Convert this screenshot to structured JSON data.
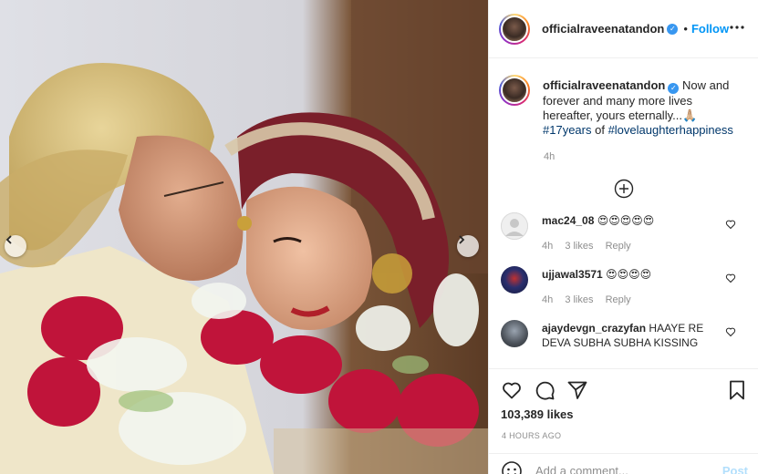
{
  "post": {
    "username": "officialraveenatandon",
    "verified_glyph": "✓",
    "separator": "•",
    "follow_label": "Follow",
    "image_description_icon": "wedding-photo",
    "caption": {
      "username": "officialraveenatandon",
      "text": "Now and forever and many more lives hereafter, yours eternally...🙏🏼 ",
      "hashtag1": "#17years",
      "of": " of ",
      "hashtag2": "#lovelaughterhappiness",
      "time": "4h"
    },
    "comments": [
      {
        "username": "mac24_08",
        "text": "😍😍😍😍😍",
        "time": "4h",
        "likes": "3 likes",
        "reply": "Reply"
      },
      {
        "username": "ujjawal3571",
        "text": "😍😍😍😍",
        "time": "4h",
        "likes": "3 likes",
        "reply": "Reply"
      },
      {
        "username": "ajaydevgn_crazyfan",
        "text": "HAAYE RE DEVA SUBHA SUBHA KISSING",
        "time": "",
        "likes": "",
        "reply": ""
      }
    ],
    "likes": "103,389 likes",
    "posted": "4 HOURS AGO",
    "add_comment_placeholder": "Add a comment...",
    "post_label": "Post"
  },
  "colors": {
    "accent": "#0095f6",
    "hashtag": "#00376b",
    "muted": "#8e8e8e",
    "post_disabled": "#b2dffc"
  }
}
